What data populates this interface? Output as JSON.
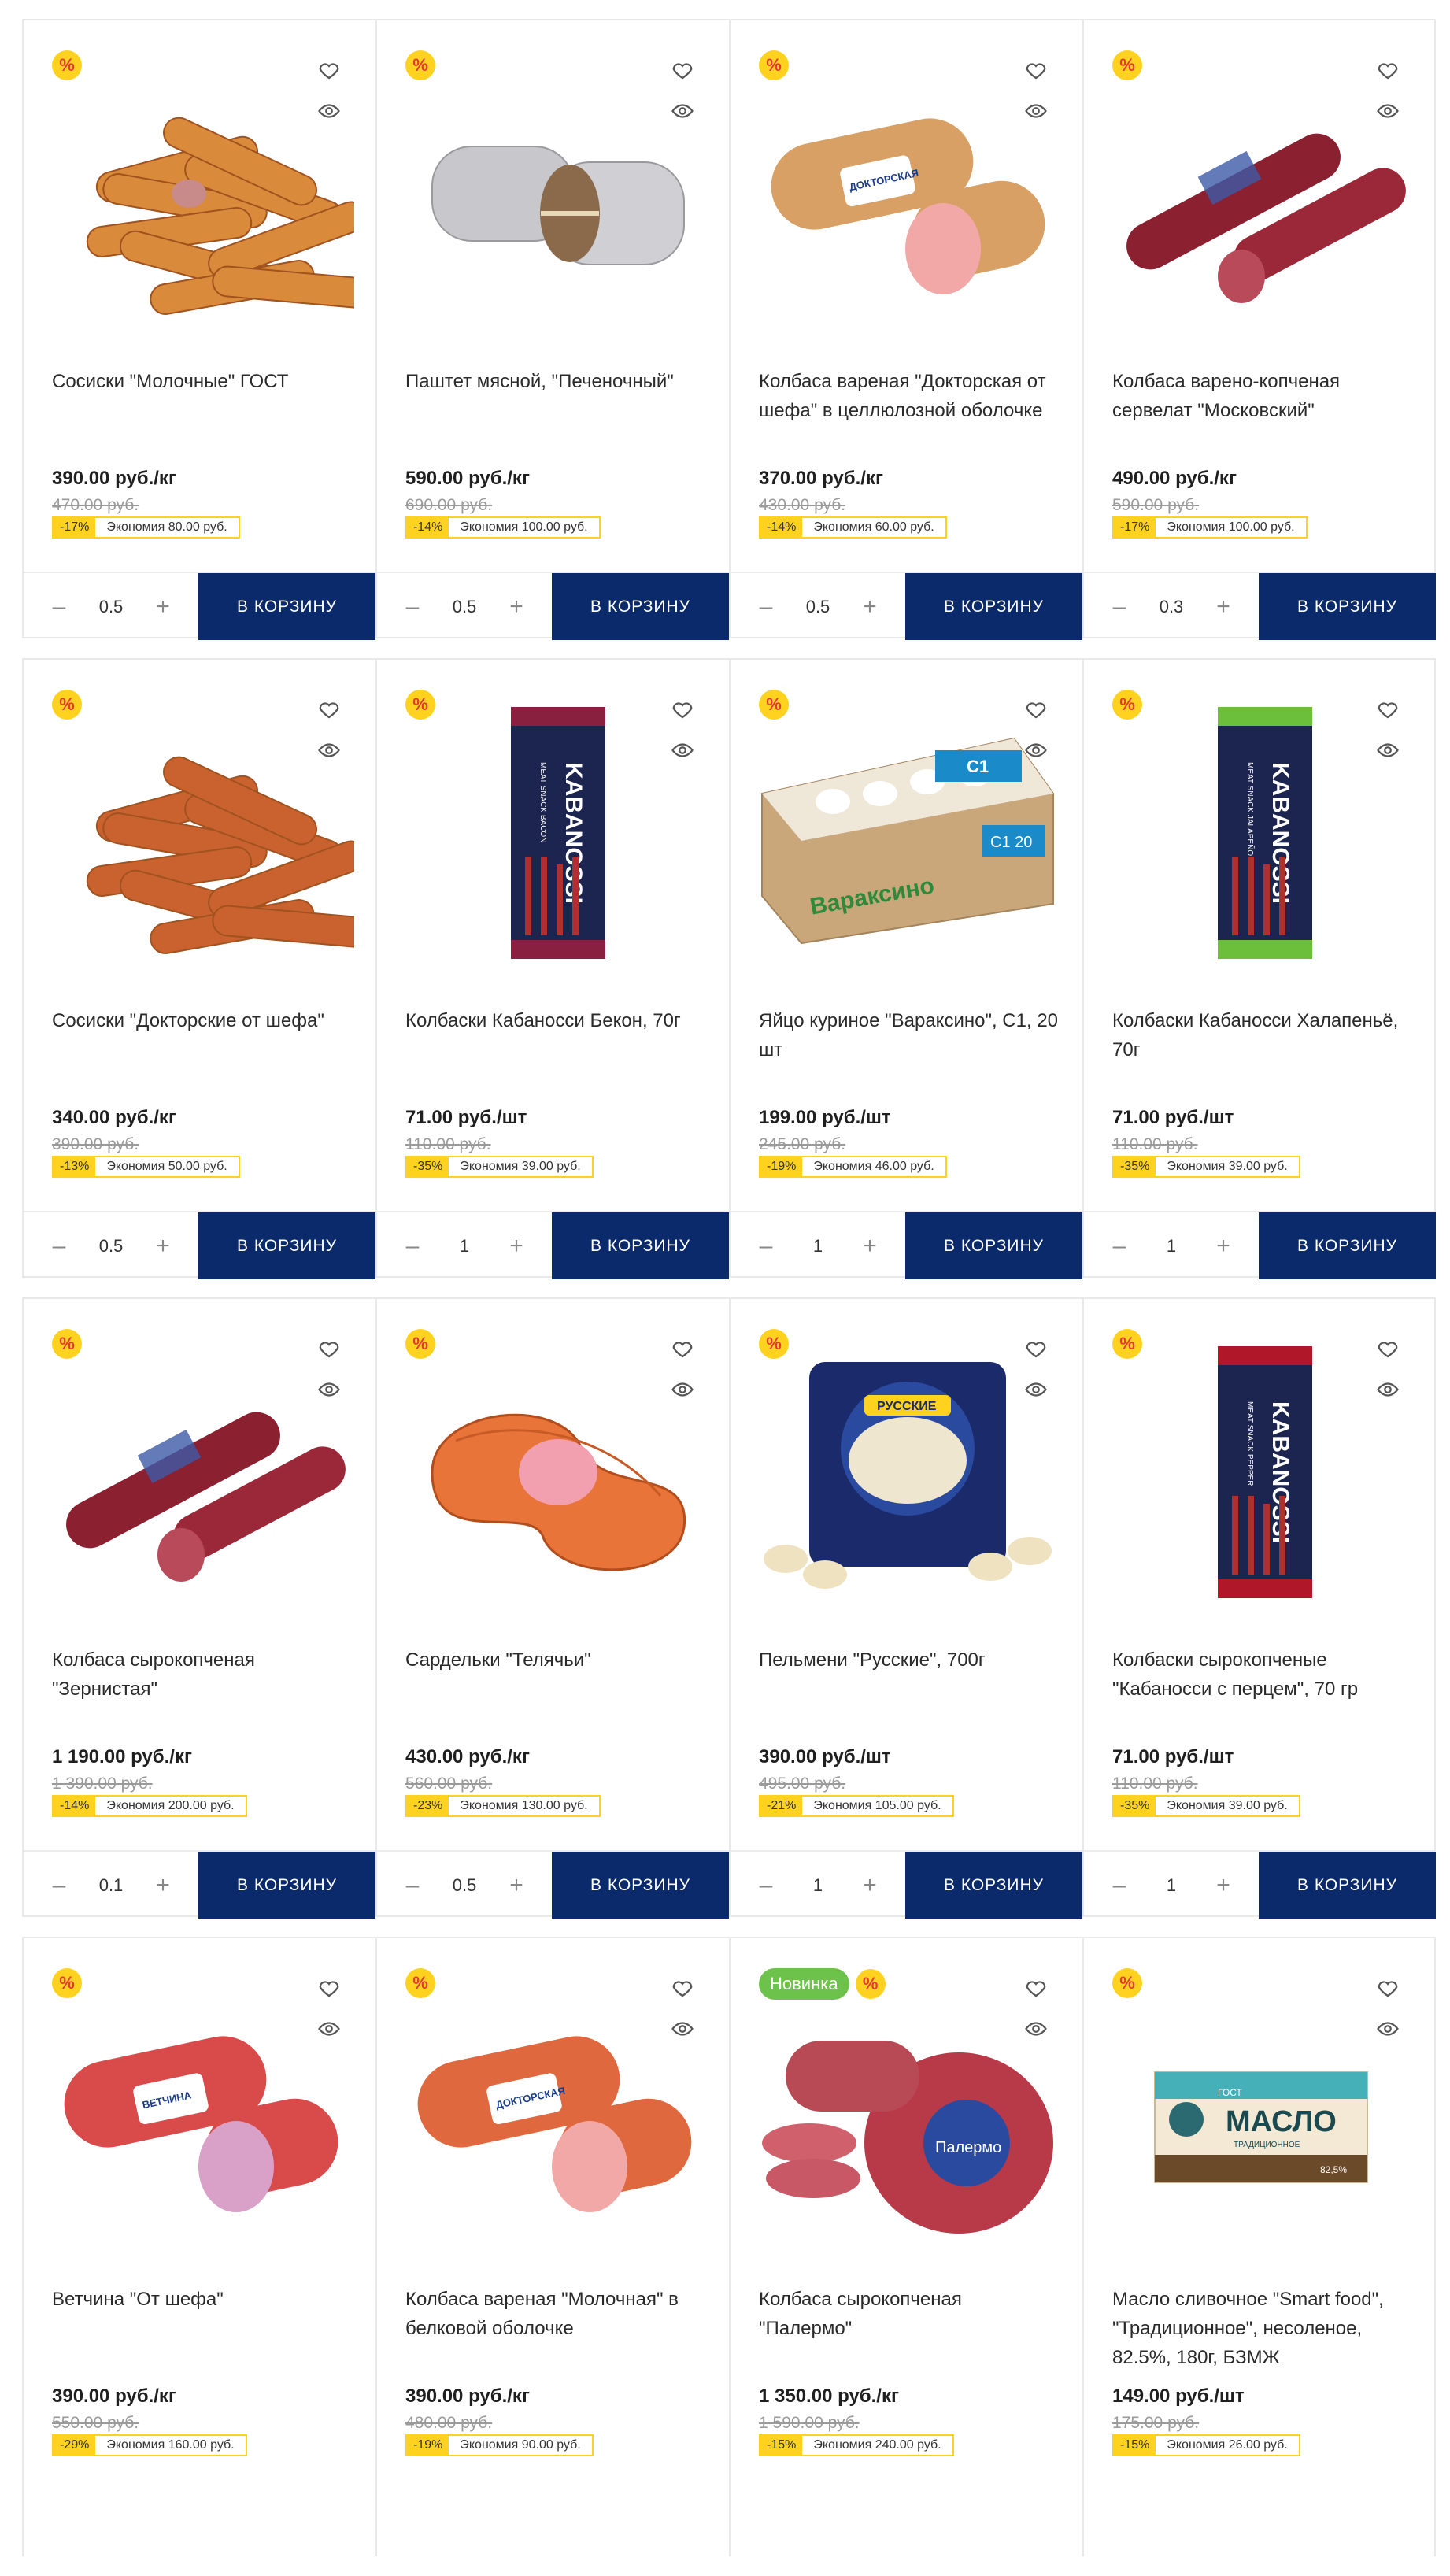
{
  "ui": {
    "discount_badge": "%",
    "new_badge": "Новинка",
    "cart_label": "В КОРЗИНУ",
    "minus": "–",
    "plus": "+"
  },
  "products": [
    {
      "name": "Сосиски \"Молочные\" ГОСТ",
      "price": "390.00 руб./кг",
      "old_price": "470.00 руб.",
      "discount": "-17%",
      "savings": "Экономия 80.00 руб.",
      "qty": "0.5",
      "image": "sausages-milk",
      "is_new": false
    },
    {
      "name": "Паштет мясной, \"Печеночный\"",
      "price": "590.00 руб./кг",
      "old_price": "690.00 руб.",
      "discount": "-14%",
      "savings": "Экономия 100.00 руб.",
      "qty": "0.5",
      "image": "pate-foil",
      "is_new": false
    },
    {
      "name": "Колбаса вареная \"Докторская от шефа\" в целлюлозной оболочке",
      "price": "370.00 руб./кг",
      "old_price": "430.00 руб.",
      "discount": "-14%",
      "savings": "Экономия 60.00 руб.",
      "qty": "0.5",
      "image": "doktorskaya",
      "is_new": false
    },
    {
      "name": "Колбаса варено-копченая сервелат \"Московский\"",
      "price": "490.00 руб./кг",
      "old_price": "590.00 руб.",
      "discount": "-17%",
      "savings": "Экономия 100.00 руб.",
      "qty": "0.3",
      "image": "servelat",
      "is_new": false
    },
    {
      "name": "Сосиски \"Докторские от шефа\"",
      "price": "340.00 руб./кг",
      "old_price": "390.00 руб.",
      "discount": "-13%",
      "savings": "Экономия 50.00 руб.",
      "qty": "0.5",
      "image": "sausages-doctor",
      "is_new": false
    },
    {
      "name": "Колбаски Кабаносси Бекон, 70г",
      "price": "71.00 руб./шт",
      "old_price": "110.00 руб.",
      "discount": "-35%",
      "savings": "Экономия 39.00 руб.",
      "qty": "1",
      "image": "kabanossi-bacon",
      "is_new": false
    },
    {
      "name": "Яйцо куриное \"Вараксино\", С1, 20 шт",
      "price": "199.00 руб./шт",
      "old_price": "245.00 руб.",
      "discount": "-19%",
      "savings": "Экономия 46.00 руб.",
      "qty": "1",
      "image": "eggs",
      "is_new": false
    },
    {
      "name": "Колбаски Кабаносси Халапеньё, 70г",
      "price": "71.00 руб./шт",
      "old_price": "110.00 руб.",
      "discount": "-35%",
      "savings": "Экономия 39.00 руб.",
      "qty": "1",
      "image": "kabanossi-jalapeno",
      "is_new": false
    },
    {
      "name": "Колбаса сырокопченая \"Зернистая\"",
      "price": "1 190.00 руб./кг",
      "old_price": "1 390.00 руб.",
      "discount": "-14%",
      "savings": "Экономия 200.00 руб.",
      "qty": "0.1",
      "image": "zernistaya",
      "is_new": false
    },
    {
      "name": "Сардельки \"Телячьи\"",
      "price": "430.00 руб./кг",
      "old_price": "560.00 руб.",
      "discount": "-23%",
      "savings": "Экономия 130.00 руб.",
      "qty": "0.5",
      "image": "sardelki",
      "is_new": false
    },
    {
      "name": "Пельмени \"Русские\", 700г",
      "price": "390.00 руб./шт",
      "old_price": "495.00 руб.",
      "discount": "-21%",
      "savings": "Экономия 105.00 руб.",
      "qty": "1",
      "image": "pelmeni",
      "is_new": false
    },
    {
      "name": "Колбаски сырокопченые \"Кабаносси с перцем\", 70 гр",
      "price": "71.00 руб./шт",
      "old_price": "110.00 руб.",
      "discount": "-35%",
      "savings": "Экономия 39.00 руб.",
      "qty": "1",
      "image": "kabanossi-pepper",
      "is_new": false
    },
    {
      "name": "Ветчина \"От шефа\"",
      "price": "390.00 руб./кг",
      "old_price": "550.00 руб.",
      "discount": "-29%",
      "savings": "Экономия 160.00 руб.",
      "qty": "",
      "image": "ham",
      "is_new": false
    },
    {
      "name": "Колбаса вареная \"Молочная\" в белковой оболочке",
      "price": "390.00 руб./кг",
      "old_price": "480.00 руб.",
      "discount": "-19%",
      "savings": "Экономия 90.00 руб.",
      "qty": "",
      "image": "molochnaya",
      "is_new": false
    },
    {
      "name": "Колбаса сырокопченая \"Палермо\"",
      "price": "1 350.00 руб./кг",
      "old_price": "1 590.00 руб.",
      "discount": "-15%",
      "savings": "Экономия 240.00 руб.",
      "qty": "",
      "image": "palermo",
      "is_new": true
    },
    {
      "name": "Масло сливочное \"Smart food\", \"Традиционное\", несоленое, 82.5%, 180г, БЗМЖ",
      "price": "149.00 руб./шт",
      "old_price": "175.00 руб.",
      "discount": "-15%",
      "savings": "Экономия 26.00 руб.",
      "qty": "",
      "image": "butter",
      "is_new": false
    }
  ],
  "artwork_text": {
    "kabanossi": "KABANOSSI",
    "meat_snack_bacon": "MEAT SNACK BACON",
    "meat_snack_jalapeno": "MEAT SNACK JALAPEÑO",
    "meat_snack_pepper": "MEAT SNACK PEPPER",
    "doktorskaya": "ДОКТОРСКАЯ",
    "vetchina": "ВЕТЧИНА",
    "eggs_brand": "Вараксино",
    "eggs_grade": "C1",
    "eggs_count": "20",
    "pelmeni": "РУССКИЕ",
    "palermo": "Палермо",
    "butter": "МАСЛО",
    "butter_sub": "ТРАДИЦИОННОЕ",
    "butter_fat": "82,5%",
    "butter_gost": "ГОСТ"
  }
}
